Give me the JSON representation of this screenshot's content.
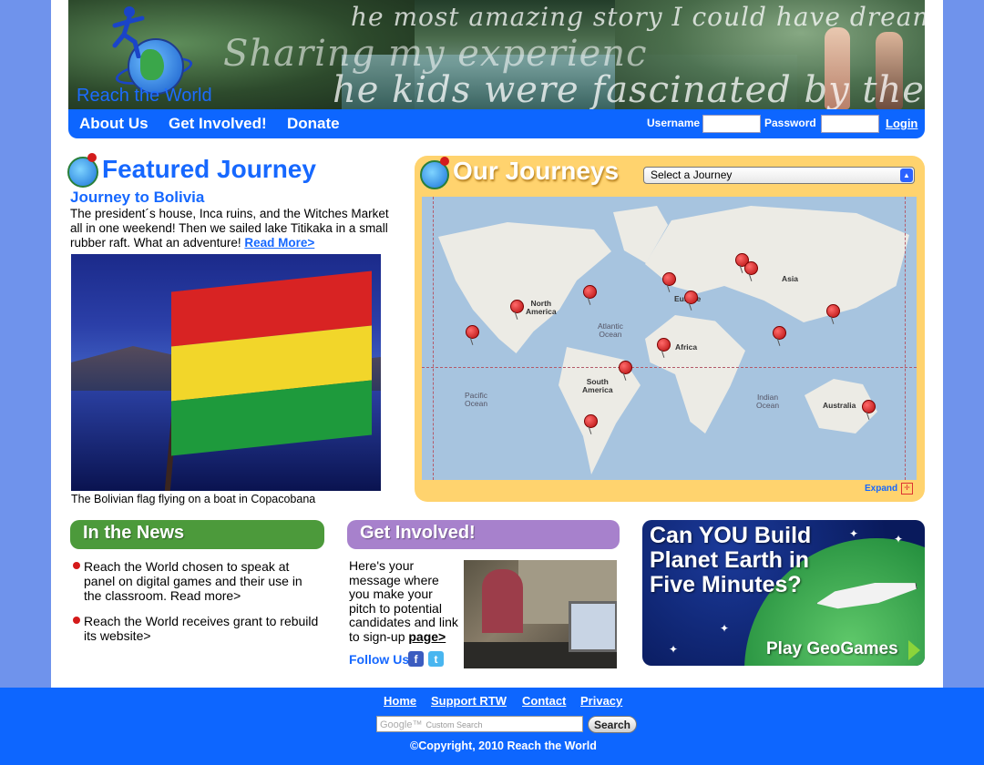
{
  "header": {
    "script_lines": [
      "he most amazing story I could have dreamed o",
      "Sharing my experienc",
      "he kids were fascinated by the perso"
    ],
    "logo_name": "Reach the World"
  },
  "nav": {
    "items": [
      "About Us",
      "Get Involved!",
      "Donate"
    ],
    "username_label": "Username",
    "password_label": "Password",
    "login_label": "Login"
  },
  "featured": {
    "heading": "Featured Journey",
    "title": "Journey to Bolivia",
    "text": "The president´s house, Inca ruins, and the Witches Market all in one weekend! Then we sailed lake Titikaka in a small rubber raft. What an adventure!",
    "read_more": "Read More>",
    "caption": "The Bolivian flag flying on a boat in Copacobana"
  },
  "journeys": {
    "heading": "Our Journeys",
    "select_value": "Select a Journey",
    "expand_label": "Expand",
    "map_labels": {
      "north_america": "North\nAmerica",
      "south_america": "South\nAmerica",
      "europe": "Europe",
      "asia": "Asia",
      "africa": "Africa",
      "australia": "Australia",
      "atlantic": "Atlantic\nOcean",
      "pacific": "Pacific\nOcean",
      "indian": "Indian\nOcean"
    }
  },
  "news": {
    "heading": "In the News",
    "items": [
      "Reach the World chosen to speak at panel on digital games and their use in the classroom. Read more>",
      "Reach the World receives grant to rebuild its website>"
    ]
  },
  "get_involved": {
    "heading": "Get Involved!",
    "text": "Here's your message where you make your pitch to potential candidates and link to sign-up",
    "link": "page>",
    "follow": "Follow Us",
    "fb": "f",
    "tw": "t"
  },
  "geogames": {
    "title": "Can YOU Build\nPlanet Earth in\nFive Minutes?",
    "play": "Play GeoGames"
  },
  "footer": {
    "links": [
      "Home",
      "Support RTW",
      "Contact",
      "Privacy"
    ],
    "search_placeholder": "Custom Search",
    "google": "Google™",
    "search_button": "Search",
    "copyright": "©Copyright, 2010 Reach the World"
  }
}
